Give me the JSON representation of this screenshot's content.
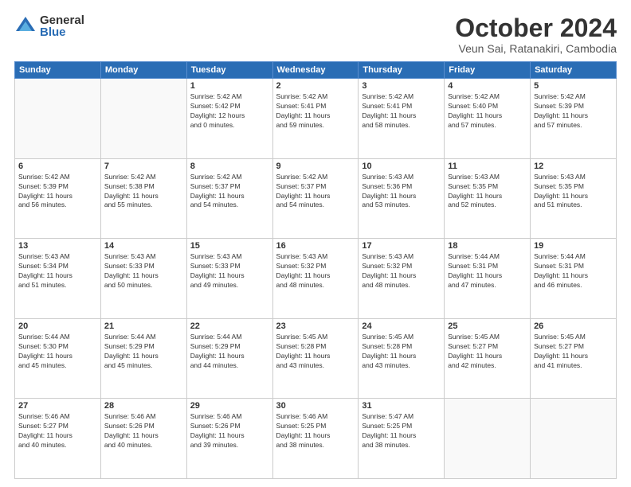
{
  "logo": {
    "general": "General",
    "blue": "Blue"
  },
  "title": "October 2024",
  "location": "Veun Sai, Ratanakiri, Cambodia",
  "days_of_week": [
    "Sunday",
    "Monday",
    "Tuesday",
    "Wednesday",
    "Thursday",
    "Friday",
    "Saturday"
  ],
  "weeks": [
    [
      {
        "day": "",
        "info": ""
      },
      {
        "day": "",
        "info": ""
      },
      {
        "day": "1",
        "info": "Sunrise: 5:42 AM\nSunset: 5:42 PM\nDaylight: 12 hours\nand 0 minutes."
      },
      {
        "day": "2",
        "info": "Sunrise: 5:42 AM\nSunset: 5:41 PM\nDaylight: 11 hours\nand 59 minutes."
      },
      {
        "day": "3",
        "info": "Sunrise: 5:42 AM\nSunset: 5:41 PM\nDaylight: 11 hours\nand 58 minutes."
      },
      {
        "day": "4",
        "info": "Sunrise: 5:42 AM\nSunset: 5:40 PM\nDaylight: 11 hours\nand 57 minutes."
      },
      {
        "day": "5",
        "info": "Sunrise: 5:42 AM\nSunset: 5:39 PM\nDaylight: 11 hours\nand 57 minutes."
      }
    ],
    [
      {
        "day": "6",
        "info": "Sunrise: 5:42 AM\nSunset: 5:39 PM\nDaylight: 11 hours\nand 56 minutes."
      },
      {
        "day": "7",
        "info": "Sunrise: 5:42 AM\nSunset: 5:38 PM\nDaylight: 11 hours\nand 55 minutes."
      },
      {
        "day": "8",
        "info": "Sunrise: 5:42 AM\nSunset: 5:37 PM\nDaylight: 11 hours\nand 54 minutes."
      },
      {
        "day": "9",
        "info": "Sunrise: 5:42 AM\nSunset: 5:37 PM\nDaylight: 11 hours\nand 54 minutes."
      },
      {
        "day": "10",
        "info": "Sunrise: 5:43 AM\nSunset: 5:36 PM\nDaylight: 11 hours\nand 53 minutes."
      },
      {
        "day": "11",
        "info": "Sunrise: 5:43 AM\nSunset: 5:35 PM\nDaylight: 11 hours\nand 52 minutes."
      },
      {
        "day": "12",
        "info": "Sunrise: 5:43 AM\nSunset: 5:35 PM\nDaylight: 11 hours\nand 51 minutes."
      }
    ],
    [
      {
        "day": "13",
        "info": "Sunrise: 5:43 AM\nSunset: 5:34 PM\nDaylight: 11 hours\nand 51 minutes."
      },
      {
        "day": "14",
        "info": "Sunrise: 5:43 AM\nSunset: 5:33 PM\nDaylight: 11 hours\nand 50 minutes."
      },
      {
        "day": "15",
        "info": "Sunrise: 5:43 AM\nSunset: 5:33 PM\nDaylight: 11 hours\nand 49 minutes."
      },
      {
        "day": "16",
        "info": "Sunrise: 5:43 AM\nSunset: 5:32 PM\nDaylight: 11 hours\nand 48 minutes."
      },
      {
        "day": "17",
        "info": "Sunrise: 5:43 AM\nSunset: 5:32 PM\nDaylight: 11 hours\nand 48 minutes."
      },
      {
        "day": "18",
        "info": "Sunrise: 5:44 AM\nSunset: 5:31 PM\nDaylight: 11 hours\nand 47 minutes."
      },
      {
        "day": "19",
        "info": "Sunrise: 5:44 AM\nSunset: 5:31 PM\nDaylight: 11 hours\nand 46 minutes."
      }
    ],
    [
      {
        "day": "20",
        "info": "Sunrise: 5:44 AM\nSunset: 5:30 PM\nDaylight: 11 hours\nand 45 minutes."
      },
      {
        "day": "21",
        "info": "Sunrise: 5:44 AM\nSunset: 5:29 PM\nDaylight: 11 hours\nand 45 minutes."
      },
      {
        "day": "22",
        "info": "Sunrise: 5:44 AM\nSunset: 5:29 PM\nDaylight: 11 hours\nand 44 minutes."
      },
      {
        "day": "23",
        "info": "Sunrise: 5:45 AM\nSunset: 5:28 PM\nDaylight: 11 hours\nand 43 minutes."
      },
      {
        "day": "24",
        "info": "Sunrise: 5:45 AM\nSunset: 5:28 PM\nDaylight: 11 hours\nand 43 minutes."
      },
      {
        "day": "25",
        "info": "Sunrise: 5:45 AM\nSunset: 5:27 PM\nDaylight: 11 hours\nand 42 minutes."
      },
      {
        "day": "26",
        "info": "Sunrise: 5:45 AM\nSunset: 5:27 PM\nDaylight: 11 hours\nand 41 minutes."
      }
    ],
    [
      {
        "day": "27",
        "info": "Sunrise: 5:46 AM\nSunset: 5:27 PM\nDaylight: 11 hours\nand 40 minutes."
      },
      {
        "day": "28",
        "info": "Sunrise: 5:46 AM\nSunset: 5:26 PM\nDaylight: 11 hours\nand 40 minutes."
      },
      {
        "day": "29",
        "info": "Sunrise: 5:46 AM\nSunset: 5:26 PM\nDaylight: 11 hours\nand 39 minutes."
      },
      {
        "day": "30",
        "info": "Sunrise: 5:46 AM\nSunset: 5:25 PM\nDaylight: 11 hours\nand 38 minutes."
      },
      {
        "day": "31",
        "info": "Sunrise: 5:47 AM\nSunset: 5:25 PM\nDaylight: 11 hours\nand 38 minutes."
      },
      {
        "day": "",
        "info": ""
      },
      {
        "day": "",
        "info": ""
      }
    ]
  ]
}
